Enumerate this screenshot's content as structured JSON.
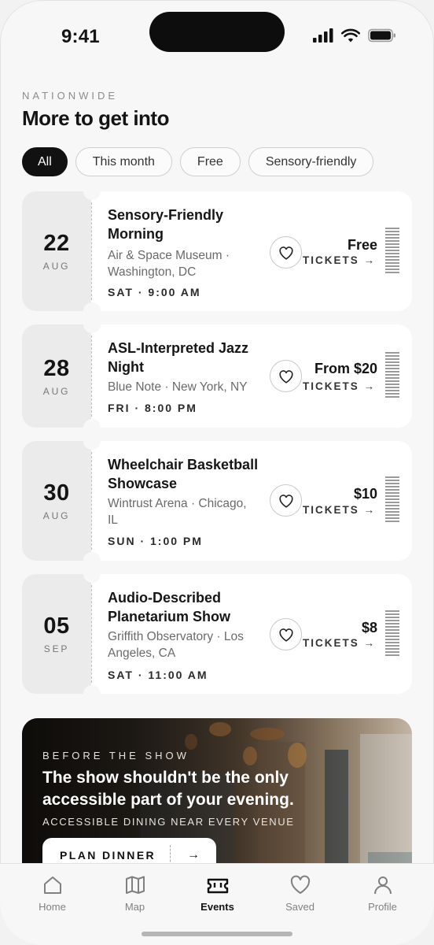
{
  "status_bar": {
    "time": "9:41"
  },
  "header": {
    "eyebrow": "NATIONWIDE",
    "title": "More to get into"
  },
  "filters": [
    {
      "label": "All",
      "selected": true
    },
    {
      "label": "This month",
      "selected": false
    },
    {
      "label": "Free",
      "selected": false
    },
    {
      "label": "Sensory-friendly",
      "selected": false
    }
  ],
  "events": [
    {
      "day": "22",
      "month": "AUG",
      "title": "Sensory-Friendly Morning",
      "venue": "Air & Space Museum · Washington, DC",
      "time": "SAT · 9:00 AM",
      "price": "Free",
      "tickets_label": "TICKETS →"
    },
    {
      "day": "28",
      "month": "AUG",
      "title": "ASL-Interpreted Jazz Night",
      "venue": "Blue Note · New York, NY",
      "time": "FRI · 8:00 PM",
      "price": "From $20",
      "tickets_label": "TICKETS →"
    },
    {
      "day": "30",
      "month": "AUG",
      "title": "Wheelchair Basketball Showcase",
      "venue": "Wintrust Arena · Chicago, IL",
      "time": "SUN · 1:00 PM",
      "price": "$10",
      "tickets_label": "TICKETS →"
    },
    {
      "day": "05",
      "month": "SEP",
      "title": "Audio-Described Planetarium Show",
      "venue": "Griffith Observatory · Los Angeles, CA",
      "time": "SAT · 11:00 AM",
      "price": "$8",
      "tickets_label": "TICKETS →"
    }
  ],
  "banner": {
    "eyebrow": "BEFORE THE SHOW",
    "title": "The show shouldn't be the only accessible part of your evening.",
    "subtitle": "ACCESSIBLE DINING NEAR EVERY VENUE",
    "button_label": "PLAN DINNER",
    "button_arrow": "→"
  },
  "tabs": [
    {
      "label": "Home",
      "icon": "home-icon",
      "active": false
    },
    {
      "label": "Map",
      "icon": "map-icon",
      "active": false
    },
    {
      "label": "Events",
      "icon": "ticket-icon",
      "active": true
    },
    {
      "label": "Saved",
      "icon": "heart-icon",
      "active": false
    },
    {
      "label": "Profile",
      "icon": "person-icon",
      "active": false
    }
  ],
  "colors": {
    "accent": "#111111",
    "background": "#f7f7f7",
    "card": "#ffffff",
    "stub": "#ebebeb"
  }
}
